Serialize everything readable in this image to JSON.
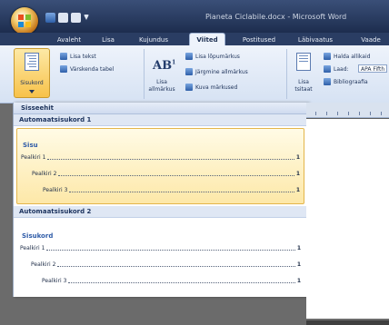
{
  "window": {
    "title": "Pianeta Ciclabile.docx - Microsoft Word"
  },
  "tabs": [
    {
      "label": "Avaleht"
    },
    {
      "label": "Lisa"
    },
    {
      "label": "Kujundus"
    },
    {
      "label": "Viited",
      "active": true
    },
    {
      "label": "Postitused"
    },
    {
      "label": "Läbivaatus"
    },
    {
      "label": "Vaade"
    }
  ],
  "ribbon": {
    "toc_button": "Sisukord",
    "add_text": "Lisa tekst",
    "update_table": "Värskenda tabel",
    "insert_footnote_line1": "Lisa",
    "insert_footnote_line2": "allmärkus",
    "insert_endnote": "Lisa lõpumärkus",
    "next_footnote": "Järgmine allmärkus",
    "show_notes": "Kuva märkused",
    "insert_citation_line1": "Lisa",
    "insert_citation_line2": "tsitaat",
    "manage_sources": "Halda allikaid",
    "style_label": "Laad:",
    "style_value": "APA Fifth",
    "bibliography": "Bibliograafia"
  },
  "gallery": {
    "header": "Sisseehit",
    "sections": [
      {
        "title": "Automaatsisukord 1",
        "heading": "Sisu",
        "lines": [
          {
            "label": "Pealkiri 1",
            "page": "1"
          },
          {
            "label": "Pealkiri 2",
            "page": "1"
          },
          {
            "label": "Pealkiri 3",
            "page": "1"
          }
        ]
      },
      {
        "title": "Automaatsisukord 2",
        "heading": "Sisukord",
        "lines": [
          {
            "label": "Pealkiri 1",
            "page": "1"
          },
          {
            "label": "Pealkiri 2",
            "page": "1"
          },
          {
            "label": "Pealkiri 3",
            "page": "1"
          }
        ]
      }
    ]
  },
  "colors": {
    "accent_hover": "#fde8a8",
    "ribbon": "#d6e2f3",
    "titlebar": "#1d2d4e"
  }
}
